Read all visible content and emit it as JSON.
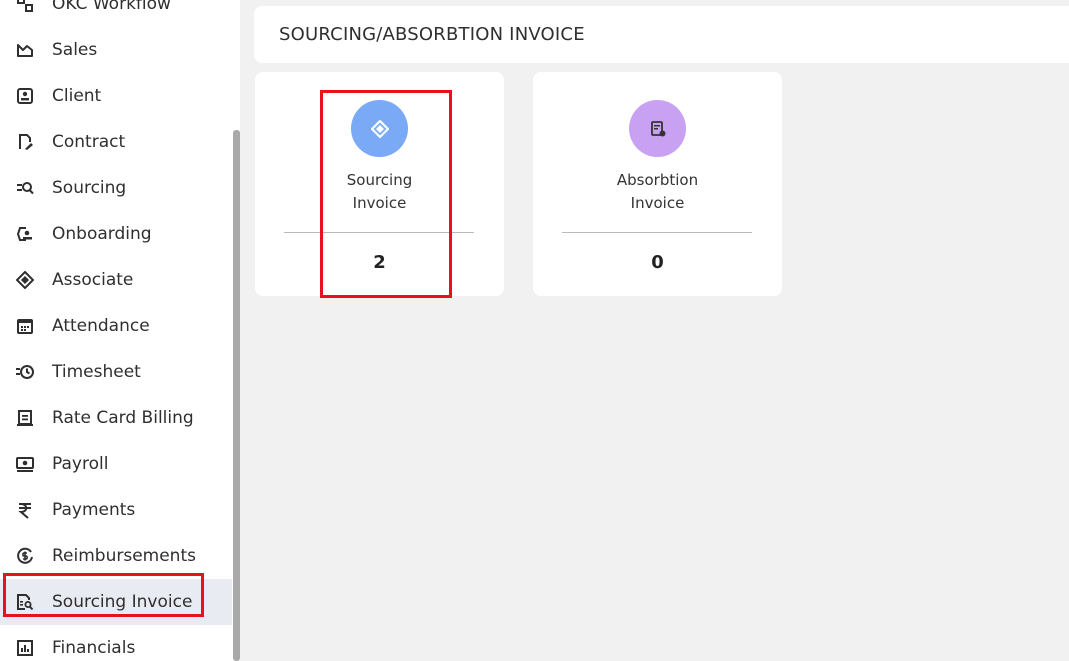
{
  "sidebar": {
    "items": [
      {
        "label": "OKC Workflow",
        "icon": "workflow-icon"
      },
      {
        "label": "Sales",
        "icon": "sales-chart-icon"
      },
      {
        "label": "Client",
        "icon": "client-id-icon"
      },
      {
        "label": "Contract",
        "icon": "contract-icon"
      },
      {
        "label": "Sourcing",
        "icon": "sourcing-search-icon"
      },
      {
        "label": "Onboarding",
        "icon": "onboarding-icon"
      },
      {
        "label": "Associate",
        "icon": "handshake-icon"
      },
      {
        "label": "Attendance",
        "icon": "calendar-icon"
      },
      {
        "label": "Timesheet",
        "icon": "timesheet-clock-icon"
      },
      {
        "label": "Rate Card Billing",
        "icon": "billing-icon"
      },
      {
        "label": "Payroll",
        "icon": "payroll-icon"
      },
      {
        "label": "Payments",
        "icon": "rupee-icon"
      },
      {
        "label": "Reimbursements",
        "icon": "reimbursement-icon"
      },
      {
        "label": "Sourcing Invoice",
        "icon": "invoice-search-icon",
        "active": true
      },
      {
        "label": "Financials",
        "icon": "financials-chart-icon"
      }
    ]
  },
  "header": {
    "title": "SOURCING/ABSORBTION INVOICE"
  },
  "tiles": [
    {
      "line1": "Sourcing",
      "line2": "Invoice",
      "count": "2",
      "icon": "handshake-icon",
      "color": "#7aaaf5"
    },
    {
      "line1": "Absorbtion",
      "line2": "Invoice",
      "count": "0",
      "icon": "receipt-icon",
      "color": "#c9a1f3"
    }
  ],
  "colors": {
    "highlight": "#e8121d",
    "active_bg": "#e9ebf2"
  }
}
